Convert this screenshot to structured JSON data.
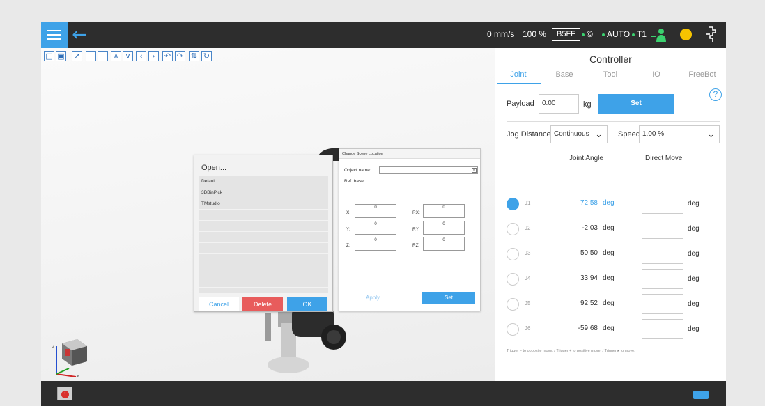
{
  "status_bar": {
    "speed": "0 mm/s",
    "speed_percent": "100 %",
    "project_code": "B5FF",
    "safety_symbol": "©",
    "mode": "AUTO",
    "operation_level": "T1",
    "icons": [
      "menu-icon",
      "back-arrow-icon",
      "operator-icon",
      "status-light-icon",
      "robot-stick-icon"
    ]
  },
  "toolbar": {
    "icons": [
      "view-front-icon",
      "view-top-icon",
      "measure-icon",
      "zoom-in-icon",
      "zoom-out-icon",
      "rotate-up-icon",
      "rotate-down-icon",
      "rotate-left-icon",
      "rotate-right-icon",
      "turn-left-icon",
      "turn-right-icon",
      "tilt-icon",
      "flip-icon"
    ],
    "glyphs": [
      "□",
      "▣",
      "↗",
      "+",
      "−",
      "∧",
      "∨",
      "‹",
      "›",
      "↶",
      "↷",
      "⇅",
      "↻"
    ]
  },
  "open_dialog": {
    "title": "Open...",
    "files": [
      "Default",
      "3DBinPick",
      "TMstudio"
    ],
    "cancel_label": "Cancel",
    "delete_label": "Delete",
    "ok_label": "OK"
  },
  "scene_dialog": {
    "title": "Change Scene Location",
    "object_name_label": "Object name:",
    "ref_base_label": "Ref. base:",
    "x_label": "X:",
    "y_label": "Y:",
    "z_label": "Z:",
    "rx_label": "RX:",
    "ry_label": "RY:",
    "rz_label": "RZ:",
    "x_value": "0",
    "y_value": "0",
    "z_value": "0",
    "rx_value": "0",
    "ry_value": "0",
    "rz_value": "0",
    "apply_label": "Apply",
    "set_label": "Set"
  },
  "gizmo": {
    "z_label": "z",
    "x_label": "x"
  },
  "controller": {
    "title": "Controller",
    "tabs": [
      "Joint",
      "Base",
      "Tool",
      "IO",
      "FreeBot"
    ],
    "active_tab": "Joint",
    "help_glyph": "?",
    "payload_label": "Payload",
    "payload_value": "0.00",
    "payload_unit": "kg",
    "set_label": "Set",
    "jog_distance_label": "Jog Distance",
    "jog_distance_value": "Continuous",
    "speed_label": "Speed",
    "speed_value": "1.00 %",
    "joint_angle_header": "Joint Angle",
    "direct_move_header": "Direct Move",
    "joints": [
      {
        "name": "J1",
        "angle": "72.58",
        "unit": "deg",
        "direct_unit": "deg",
        "selected": true
      },
      {
        "name": "J2",
        "angle": "-2.03",
        "unit": "deg",
        "direct_unit": "deg",
        "selected": false
      },
      {
        "name": "J3",
        "angle": "50.50",
        "unit": "deg",
        "direct_unit": "deg",
        "selected": false
      },
      {
        "name": "J4",
        "angle": "33.94",
        "unit": "deg",
        "direct_unit": "deg",
        "selected": false
      },
      {
        "name": "J5",
        "angle": "92.52",
        "unit": "deg",
        "direct_unit": "deg",
        "selected": false
      },
      {
        "name": "J6",
        "angle": "-59.68",
        "unit": "deg",
        "direct_unit": "deg",
        "selected": false
      }
    ],
    "footnote": "Trigger − to opposite move. / Trigger + to positive move. / Trigger ▸ to move."
  },
  "colors": {
    "accent": "#3ea2e8",
    "bar": "#2d2d2d",
    "danger": "#e85c5c",
    "status_green": "#3bd16f",
    "status_yellow": "#f6c400"
  }
}
